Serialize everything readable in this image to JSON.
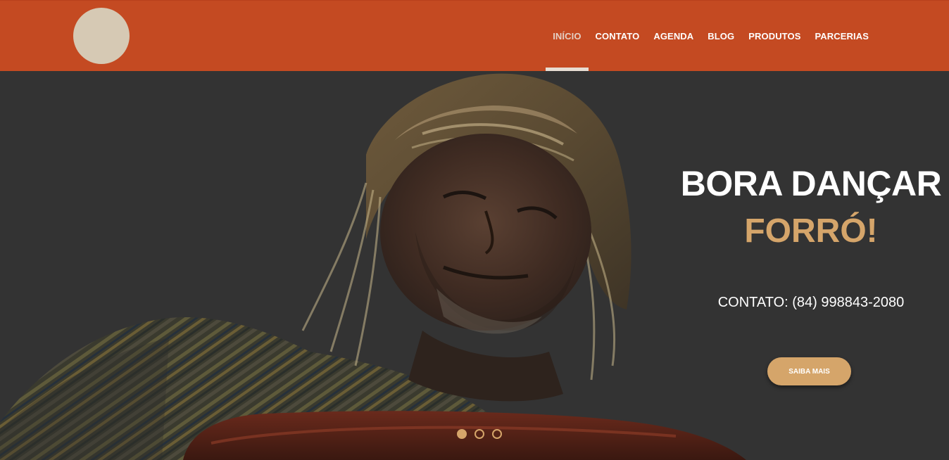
{
  "header": {
    "logo_icon": "logo-circle-icon",
    "nav": [
      {
        "label": "INÍCIO",
        "active": true
      },
      {
        "label": "CONTATO",
        "active": false
      },
      {
        "label": "AGENDA",
        "active": false
      },
      {
        "label": "BLOG",
        "active": false
      },
      {
        "label": "PRODUTOS",
        "active": false
      },
      {
        "label": "PARCERIAS",
        "active": false
      }
    ]
  },
  "hero": {
    "image": "forro-elderly-man-with-leather-hat",
    "headline": "BORA DANÇAR",
    "headline_accent": "FORRÓ!",
    "contact_line": "CONTATO: (84) 998843-2080",
    "cta_label": "SAIBA MAIS",
    "slides": {
      "count": 3,
      "active_index": 0
    }
  },
  "colors": {
    "header_bg": "#c44a22",
    "accent": "#d5a56a",
    "hero_bg": "#333333",
    "text": "#ffffff"
  }
}
